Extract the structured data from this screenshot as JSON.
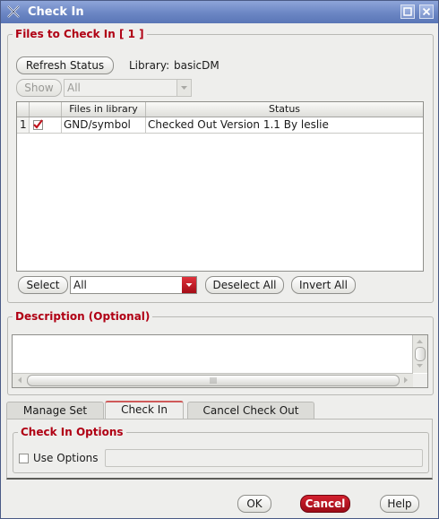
{
  "window": {
    "title": "Check In"
  },
  "files_group": {
    "title": "Files to Check In [ 1 ]",
    "refresh_label": "Refresh Status",
    "library_label": "Library:",
    "library_value": "basicDM",
    "show_label": "Show",
    "show_value": "All"
  },
  "table": {
    "headers": [
      "Files in library",
      "Status"
    ],
    "rows": [
      {
        "index": "1",
        "checked": true,
        "file": "GND/symbol",
        "status": "Checked Out Version 1.1 By leslie"
      }
    ]
  },
  "selection": {
    "select_label": "Select",
    "select_value": "All",
    "deselect_label": "Deselect All",
    "invert_label": "Invert All"
  },
  "description": {
    "title": "Description (Optional)",
    "value": ""
  },
  "tabs": [
    {
      "label": "Manage Set",
      "active": false
    },
    {
      "label": "Check In",
      "active": true
    },
    {
      "label": "Cancel Check Out",
      "active": false
    }
  ],
  "options": {
    "title": "Check In Options",
    "use_options_label": "Use Options",
    "use_options_checked": false
  },
  "footer": {
    "ok_label": "OK",
    "cancel_label": "Cancel",
    "help_label": "Help"
  },
  "colors": {
    "accent": "#b00014",
    "titlebar": "#6b86c4",
    "cancel_button": "#b8101c"
  }
}
